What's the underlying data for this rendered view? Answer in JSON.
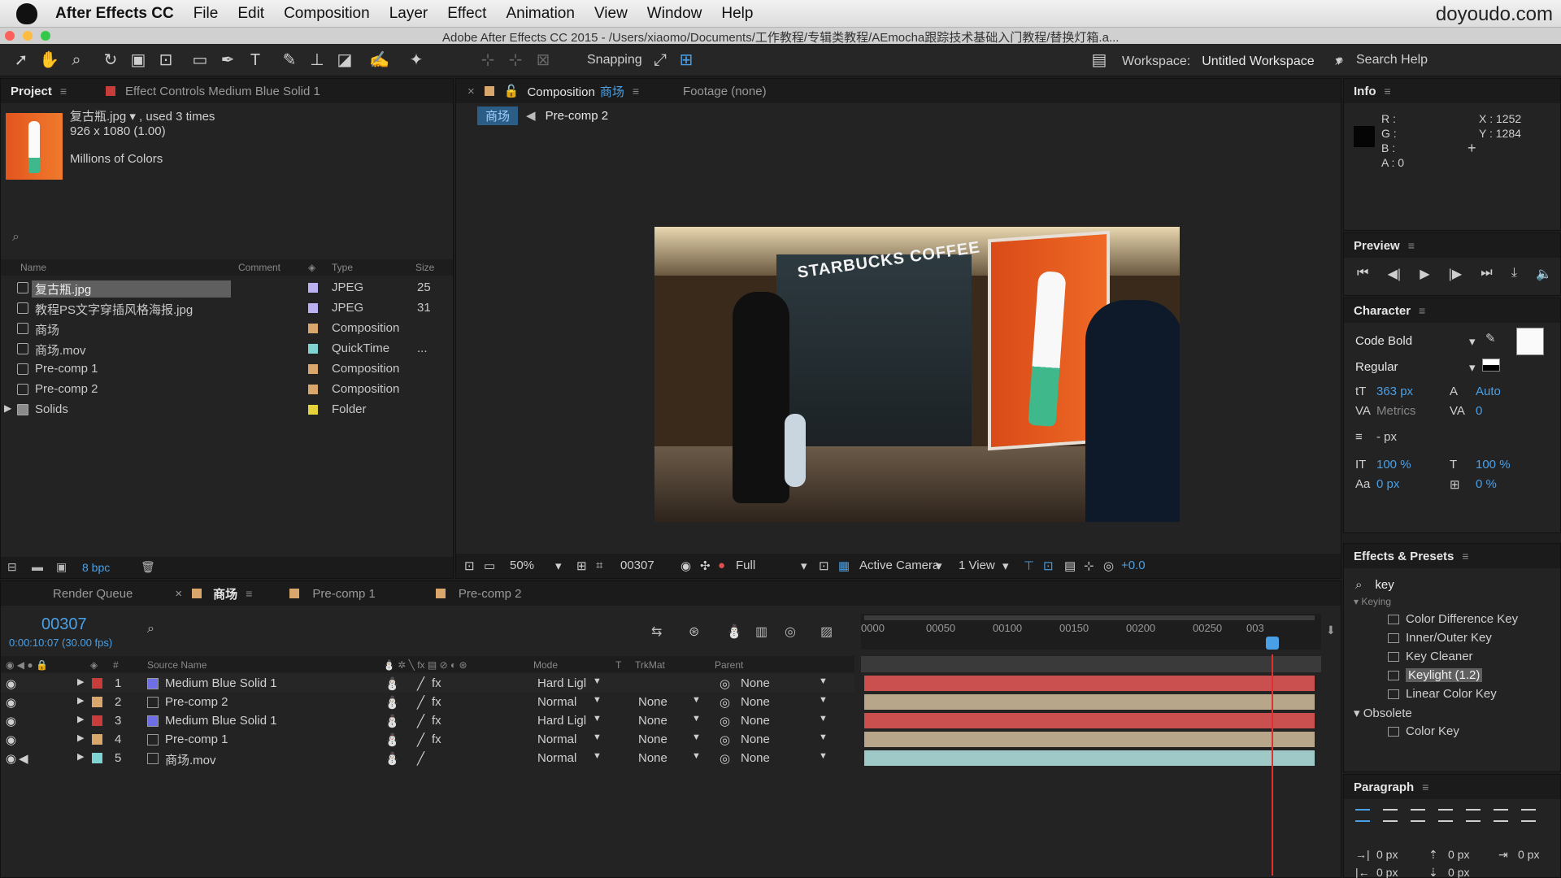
{
  "menubar": {
    "app": "After Effects CC",
    "items": [
      "File",
      "Edit",
      "Composition",
      "Layer",
      "Effect",
      "Animation",
      "View",
      "Window",
      "Help"
    ],
    "brand": "doyoudo.com"
  },
  "window": {
    "title": "Adobe After Effects CC 2015 - /Users/xiaomo/Documents/工作教程/专辑类教程/AEmocha跟踪技术基础入门教程/替换灯箱.a..."
  },
  "toolbar": {
    "snapping": "Snapping",
    "workspace_label": "Workspace:",
    "workspace_value": "Untitled Workspace",
    "search_help": "Search Help"
  },
  "project": {
    "tab": "Project",
    "effect_tab": "Effect Controls Medium Blue Solid 1",
    "file_name": "复古瓶.jpg ▾ , used 3 times",
    "file_dims": "926 x 1080 (1.00)",
    "file_colors": "Millions of Colors",
    "columns": {
      "name": "Name",
      "comment": "Comment",
      "type": "Type",
      "size": "Size"
    },
    "items": [
      {
        "name": "复古瓶.jpg",
        "type": "JPEG",
        "size": "25",
        "color": "#b9b1f0"
      },
      {
        "name": "教程PS文字穿插风格海报.jpg",
        "type": "JPEG",
        "size": "31",
        "color": "#b9b1f0"
      },
      {
        "name": "商场",
        "type": "Composition",
        "size": "",
        "color": "#d9a66b"
      },
      {
        "name": "商场.mov",
        "type": "QuickTime",
        "size": "...",
        "color": "#7fd3d0"
      },
      {
        "name": "Pre-comp 1",
        "type": "Composition",
        "size": "",
        "color": "#d9a66b"
      },
      {
        "name": "Pre-comp 2",
        "type": "Composition",
        "size": "",
        "color": "#d9a66b"
      },
      {
        "name": "Solids",
        "type": "Folder",
        "size": "",
        "color": "#e6d23a"
      }
    ],
    "bpc": "8 bpc"
  },
  "viewer": {
    "comp_label": "Composition",
    "comp_name": "商场",
    "footage": "Footage (none)",
    "crumb1": "商场",
    "crumb2": "Pre-comp 2",
    "store_sign": "STARBUCKS COFFEE",
    "zoom": "50%",
    "timecode": "00307",
    "resolution": "Full",
    "camera": "Active Camera",
    "views": "1 View",
    "exposure": "+0.0"
  },
  "info": {
    "title": "Info",
    "r": "R :",
    "g": "G :",
    "b": "B :",
    "a": "A : 0",
    "x": "X : 1252",
    "y": "Y : 1284"
  },
  "preview": {
    "title": "Preview"
  },
  "character": {
    "title": "Character",
    "font": "Code Bold",
    "style": "Regular",
    "size": "363 px",
    "leading": "Auto",
    "kerning": "Metrics",
    "tracking": "0",
    "stroke": "- px",
    "vscale": "100 %",
    "hscale": "100 %",
    "baseline": "0 px",
    "tsume": "0 %"
  },
  "effects": {
    "title": "Effects & Presets",
    "query": "key",
    "group1": "Keying",
    "items": [
      "Color Difference Key",
      "Inner/Outer Key",
      "Key Cleaner",
      "Keylight (1.2)",
      "Linear Color Key"
    ],
    "group2": "Obsolete",
    "items2": [
      "Color Key"
    ]
  },
  "paragraph": {
    "title": "Paragraph",
    "v1": "0 px",
    "v2": "0 px",
    "v3": "0 px",
    "v4": "0 px",
    "v5": "0 px"
  },
  "timeline": {
    "render_queue": "Render Queue",
    "active_tab": "商场",
    "tab2": "Pre-comp 1",
    "tab3": "Pre-comp 2",
    "timecode": "00307",
    "timecode_sub": "0:00:10:07 (30.00 fps)",
    "columns": {
      "source": "Source Name",
      "mode": "Mode",
      "t": "T",
      "trkmat": "TrkMat",
      "parent": "Parent"
    },
    "ruler": [
      "0000",
      "00050",
      "00100",
      "00150",
      "00200",
      "00250",
      "003"
    ],
    "layers": [
      {
        "num": "1",
        "name": "Medium Blue Solid 1",
        "mode": "Hard Ligl",
        "trkmat": "",
        "parent": "None",
        "label": "#c83c3c",
        "icon": "#6e6ee6",
        "bar": "#c9504f"
      },
      {
        "num": "2",
        "name": "Pre-comp 2",
        "mode": "Normal",
        "trkmat": "None",
        "parent": "None",
        "label": "#d9a66b",
        "icon": "#cfcfcf",
        "bar": "#b8a68b"
      },
      {
        "num": "3",
        "name": "Medium Blue Solid 1",
        "mode": "Hard Ligl",
        "trkmat": "None",
        "parent": "None",
        "label": "#c83c3c",
        "icon": "#6e6ee6",
        "bar": "#c9504f"
      },
      {
        "num": "4",
        "name": "Pre-comp 1",
        "mode": "Normal",
        "trkmat": "None",
        "parent": "None",
        "label": "#d9a66b",
        "icon": "#cfcfcf",
        "bar": "#b8a68b"
      },
      {
        "num": "5",
        "name": "商场.mov",
        "mode": "Normal",
        "trkmat": "None",
        "parent": "None",
        "label": "#7fd3d0",
        "icon": "#cfcfcf",
        "bar": "#9ec9c7"
      }
    ]
  }
}
